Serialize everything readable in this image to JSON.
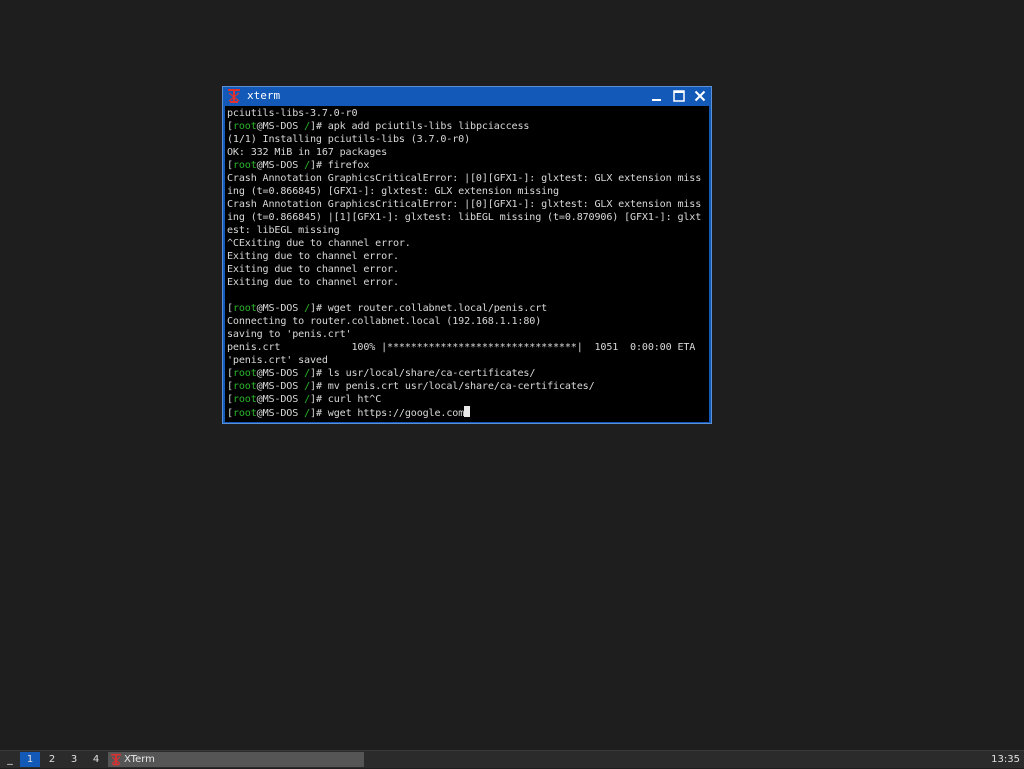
{
  "window": {
    "title": "xterm",
    "icon": "xterm-x-icon",
    "minimize_icon": "minimize-icon",
    "maximize_icon": "maximize-icon",
    "close_icon": "close-icon"
  },
  "terminal": {
    "lines": [
      {
        "text": "pciutils-libs-3.7.0-r0"
      },
      {
        "prompt": {
          "bracket_open": "[",
          "user": "root",
          "at": "@",
          "host": "MS-DOS",
          "path": " /",
          "bracket_close": "]# "
        },
        "text": "apk add pciutils-libs libpciaccess"
      },
      {
        "text": "(1/1) Installing pciutils-libs (3.7.0-r0)"
      },
      {
        "text": "OK: 332 MiB in 167 packages"
      },
      {
        "prompt": {
          "bracket_open": "[",
          "user": "root",
          "at": "@",
          "host": "MS-DOS",
          "path": " /",
          "bracket_close": "]# "
        },
        "text": "firefox"
      },
      {
        "text": "Crash Annotation GraphicsCriticalError: |[0][GFX1-]: glxtest: GLX extension miss"
      },
      {
        "text": "ing (t=0.866845) [GFX1-]: glxtest: GLX extension missing"
      },
      {
        "text": "Crash Annotation GraphicsCriticalError: |[0][GFX1-]: glxtest: GLX extension miss"
      },
      {
        "text": "ing (t=0.866845) |[1][GFX1-]: glxtest: libEGL missing (t=0.870906) [GFX1-]: glxt"
      },
      {
        "text": "est: libEGL missing"
      },
      {
        "text": "^CExiting due to channel error."
      },
      {
        "text": "Exiting due to channel error."
      },
      {
        "text": "Exiting due to channel error."
      },
      {
        "text": "Exiting due to channel error."
      },
      {
        "text": ""
      },
      {
        "prompt": {
          "bracket_open": "[",
          "user": "root",
          "at": "@",
          "host": "MS-DOS",
          "path": " /",
          "bracket_close": "]# "
        },
        "text": "wget router.collabnet.local/penis.crt"
      },
      {
        "text": "Connecting to router.collabnet.local (192.168.1.1:80)"
      },
      {
        "text": "saving to 'penis.crt'"
      },
      {
        "text": "penis.crt            100% |********************************|  1051  0:00:00 ETA"
      },
      {
        "text": "'penis.crt' saved"
      },
      {
        "prompt": {
          "bracket_open": "[",
          "user": "root",
          "at": "@",
          "host": "MS-DOS",
          "path": " /",
          "bracket_close": "]# "
        },
        "text": "ls usr/local/share/ca-certificates/"
      },
      {
        "prompt": {
          "bracket_open": "[",
          "user": "root",
          "at": "@",
          "host": "MS-DOS",
          "path": " /",
          "bracket_close": "]# "
        },
        "text": "mv penis.crt usr/local/share/ca-certificates/"
      },
      {
        "prompt": {
          "bracket_open": "[",
          "user": "root",
          "at": "@",
          "host": "MS-DOS",
          "path": " /",
          "bracket_close": "]# "
        },
        "text": "curl ht^C"
      },
      {
        "prompt": {
          "bracket_open": "[",
          "user": "root",
          "at": "@",
          "host": "MS-DOS",
          "path": " /",
          "bracket_close": "]# "
        },
        "text": "wget https://google.com",
        "cursor": true
      }
    ]
  },
  "taskbar": {
    "menu_label": "_",
    "workspaces": [
      "1",
      "2",
      "3",
      "4"
    ],
    "active_workspace": "1",
    "task": {
      "label": "XTerm",
      "icon": "xterm-x-icon"
    },
    "clock": "13:35"
  },
  "colors": {
    "titlebar": "#1359b8",
    "prompt_green": "#2bb52b",
    "desktop": "#1e1e1e"
  }
}
